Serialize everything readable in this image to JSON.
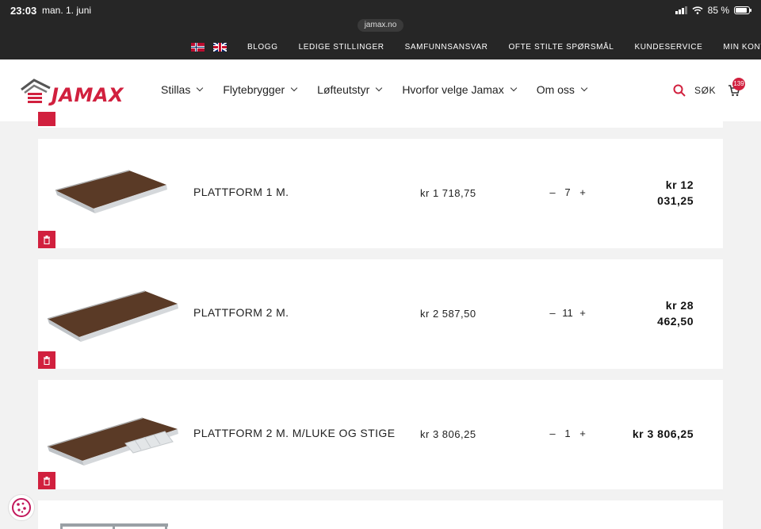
{
  "status_bar": {
    "time": "23:03",
    "date": "man. 1. juni",
    "battery": "85 %",
    "url": "jamax.no"
  },
  "util_nav": {
    "languages": [
      "norwegian-flag-icon",
      "uk-flag-icon"
    ],
    "links": [
      "BLOGG",
      "LEDIGE STILLINGER",
      "SAMFUNNSANSVAR",
      "OFTE STILTE SPØRSMÅL",
      "KUNDESERVICE",
      "MIN KONTO"
    ]
  },
  "header": {
    "logo_text": "JAMAX",
    "nav": [
      "Stillas",
      "Flytebrygger",
      "Løfteutstyr",
      "Hvorfor velge Jamax",
      "Om oss"
    ],
    "search_label": "SØK",
    "cart_count": "139"
  },
  "cart": {
    "items": [
      {
        "name": "PLATTFORM 1 M.",
        "unit_price": "kr 1 718,75",
        "quantity": "7",
        "total_line1": "kr 12",
        "total_line2": "031,25"
      },
      {
        "name": "PLATTFORM 2 M.",
        "unit_price": "kr 2 587,50",
        "quantity": "11",
        "total_line1": "kr 28",
        "total_line2": "462,50"
      },
      {
        "name": "PLATTFORM 2 M. M/LUKE OG STIGE",
        "unit_price": "kr 3 806,25",
        "quantity": "1",
        "total_line1": "kr 3 806,25",
        "total_line2": ""
      }
    ],
    "qty_minus": "–",
    "qty_plus": "+"
  },
  "colors": {
    "brand": "#d1203e",
    "topbar": "#262626",
    "background": "#f2f2f2"
  }
}
